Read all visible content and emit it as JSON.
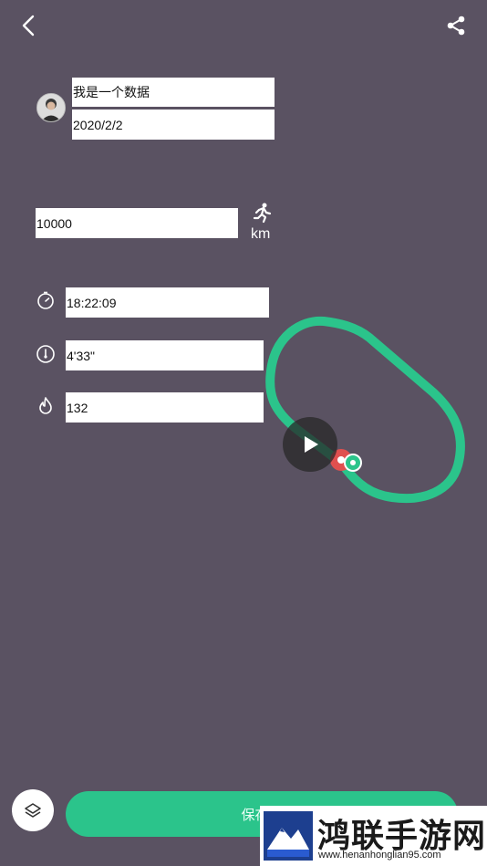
{
  "header": {
    "back_icon": "chevron-left-icon",
    "share_icon": "share-icon"
  },
  "profile": {
    "name": "我是一个数据",
    "date": "2020/2/2"
  },
  "distance": {
    "value": "10000",
    "unit": "km",
    "icon": "running-icon"
  },
  "stats": {
    "duration": "18:22:09",
    "pace": "4'33\"",
    "calories": "132"
  },
  "map": {
    "route_color": "#2bc48b",
    "start_marker_color": "#e0504f",
    "play_icon": "play-icon"
  },
  "footer": {
    "save_label": "保存并",
    "layers_icon": "layers-icon"
  },
  "watermark": {
    "title": "鸿联手游网",
    "url": "www.henanhonglian95.com"
  },
  "colors": {
    "background": "#5a5262",
    "accent": "#2bc48b"
  }
}
